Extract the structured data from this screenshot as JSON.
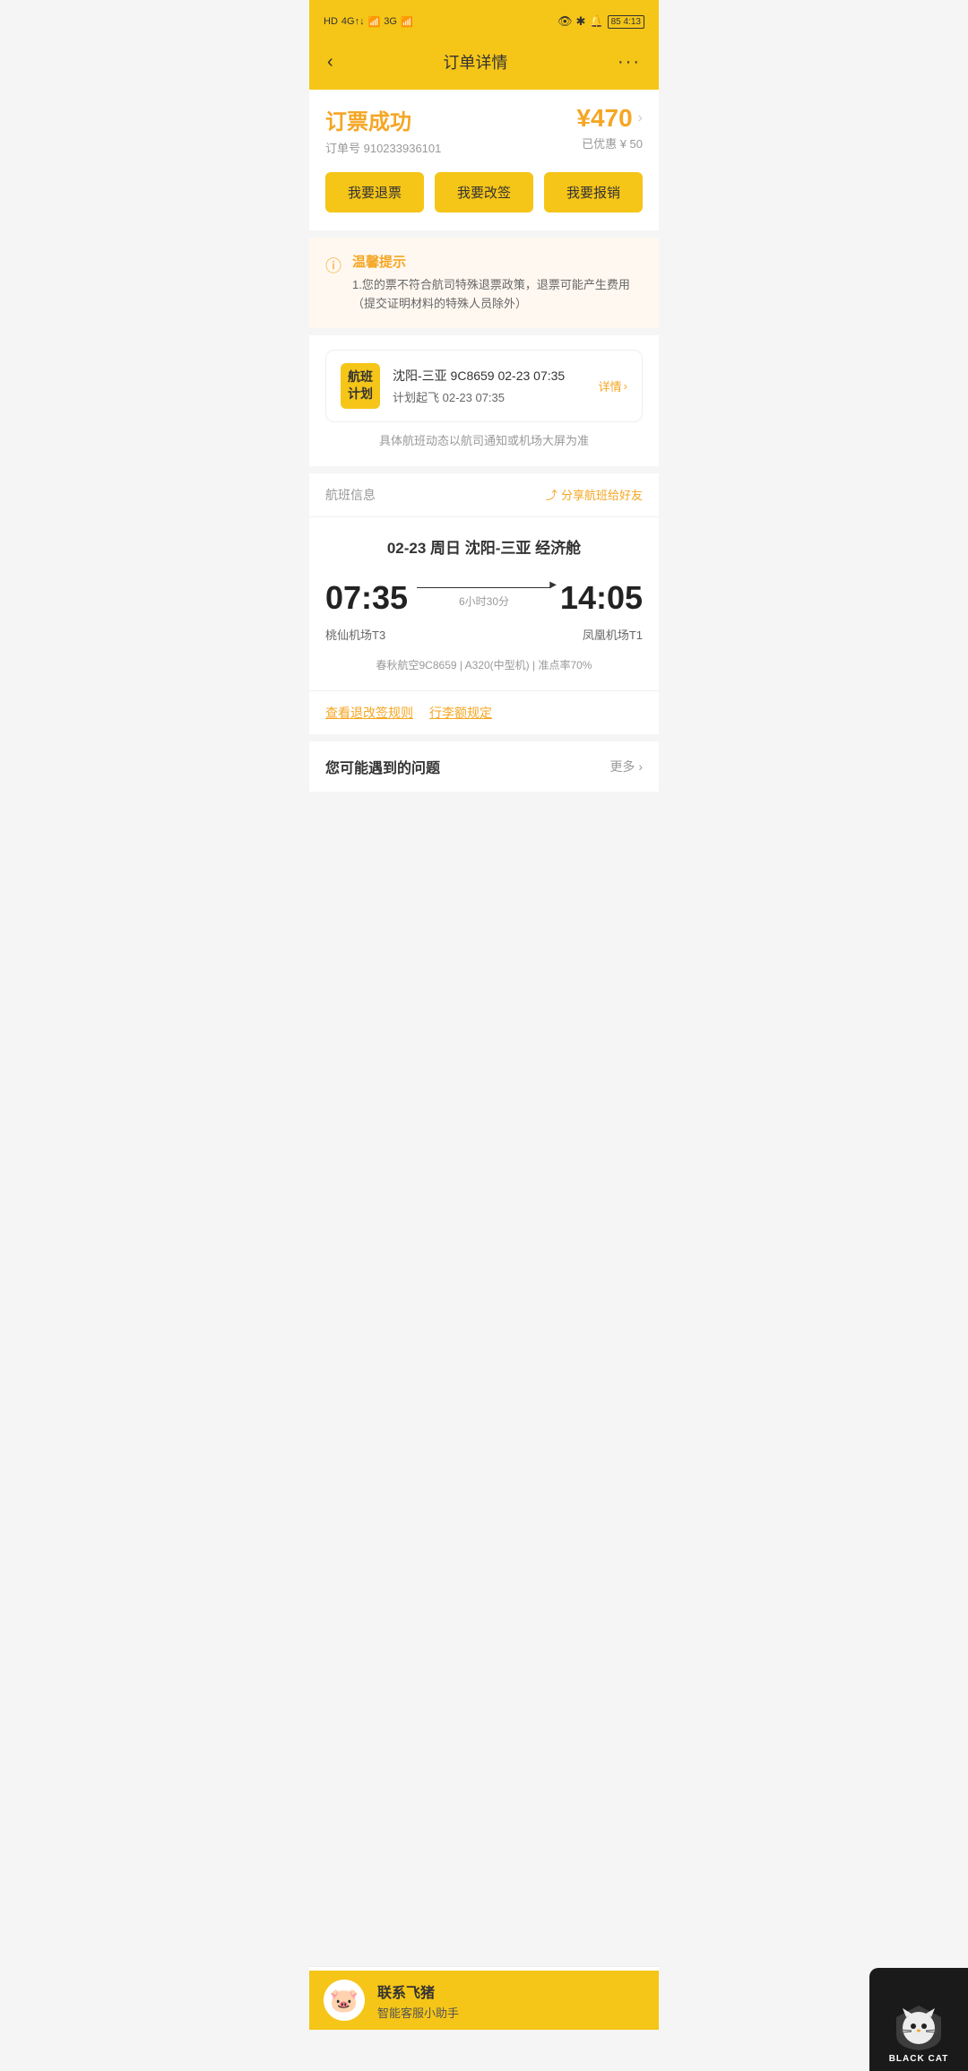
{
  "statusBar": {
    "leftText": "HD 4G 46 3G",
    "rightText": "85 4:13"
  },
  "header": {
    "backLabel": "‹",
    "title": "订单详情",
    "moreLabel": "···"
  },
  "successCard": {
    "title": "订票成功",
    "priceLabel": "¥470",
    "orderNo": "订单号 910233936101",
    "discountLabel": "已优惠 ¥ 50",
    "btn1": "我要退票",
    "btn2": "我要改签",
    "btn3": "我要报销"
  },
  "notice": {
    "title": "温馨提示",
    "text": "1.您的票不符合航司特殊退票政策，退票可能产生费用（提交证明材料的特殊人员除外）"
  },
  "flightPlan": {
    "badgeLine1": "航班",
    "badgeLine2": "计划",
    "route": "沈阳-三亚 9C8659 02-23 07:35",
    "planTime": "计划起飞 02-23 07:35",
    "detailLabel": "详情",
    "dynamicHint": "具体航班动态以航司通知或机场大屏为准"
  },
  "flightInfo": {
    "label": "航班信息",
    "shareLabel": "分享航班给好友",
    "dateRoute": "02-23  周日  沈阳-三亚  经济舱",
    "depTime": "07:35",
    "arrTime": "14:05",
    "duration": "6小时30分",
    "depAirport": "桃仙机场T3",
    "arrAirport": "凤凰机场T1",
    "airlineInfo": "春秋航空9C8659  |  A320(中型机)  |  准点率70%"
  },
  "links": {
    "link1": "查看退改签规则",
    "link2": "行李额规定"
  },
  "faq": {
    "title": "您可能遇到的问题",
    "moreLabel": "更多 ›"
  },
  "contactBar": {
    "name": "联系飞猪",
    "sub": "智能客服小助手"
  },
  "blackCat": {
    "text": "BLACK CAT"
  }
}
